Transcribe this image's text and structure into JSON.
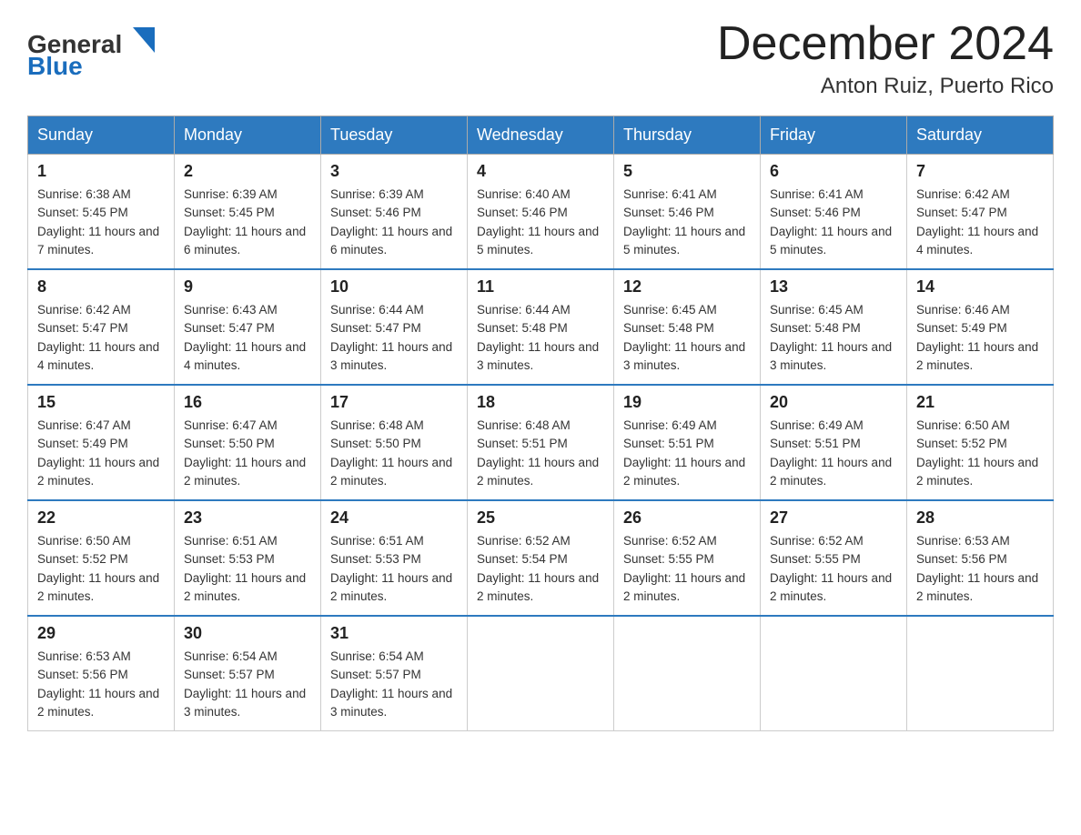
{
  "header": {
    "logo_text_general": "General",
    "logo_text_blue": "Blue",
    "title": "December 2024",
    "subtitle": "Anton Ruiz, Puerto Rico"
  },
  "calendar": {
    "headers": [
      "Sunday",
      "Monday",
      "Tuesday",
      "Wednesday",
      "Thursday",
      "Friday",
      "Saturday"
    ],
    "weeks": [
      [
        {
          "day": "1",
          "sunrise": "Sunrise: 6:38 AM",
          "sunset": "Sunset: 5:45 PM",
          "daylight": "Daylight: 11 hours and 7 minutes."
        },
        {
          "day": "2",
          "sunrise": "Sunrise: 6:39 AM",
          "sunset": "Sunset: 5:45 PM",
          "daylight": "Daylight: 11 hours and 6 minutes."
        },
        {
          "day": "3",
          "sunrise": "Sunrise: 6:39 AM",
          "sunset": "Sunset: 5:46 PM",
          "daylight": "Daylight: 11 hours and 6 minutes."
        },
        {
          "day": "4",
          "sunrise": "Sunrise: 6:40 AM",
          "sunset": "Sunset: 5:46 PM",
          "daylight": "Daylight: 11 hours and 5 minutes."
        },
        {
          "day": "5",
          "sunrise": "Sunrise: 6:41 AM",
          "sunset": "Sunset: 5:46 PM",
          "daylight": "Daylight: 11 hours and 5 minutes."
        },
        {
          "day": "6",
          "sunrise": "Sunrise: 6:41 AM",
          "sunset": "Sunset: 5:46 PM",
          "daylight": "Daylight: 11 hours and 5 minutes."
        },
        {
          "day": "7",
          "sunrise": "Sunrise: 6:42 AM",
          "sunset": "Sunset: 5:47 PM",
          "daylight": "Daylight: 11 hours and 4 minutes."
        }
      ],
      [
        {
          "day": "8",
          "sunrise": "Sunrise: 6:42 AM",
          "sunset": "Sunset: 5:47 PM",
          "daylight": "Daylight: 11 hours and 4 minutes."
        },
        {
          "day": "9",
          "sunrise": "Sunrise: 6:43 AM",
          "sunset": "Sunset: 5:47 PM",
          "daylight": "Daylight: 11 hours and 4 minutes."
        },
        {
          "day": "10",
          "sunrise": "Sunrise: 6:44 AM",
          "sunset": "Sunset: 5:47 PM",
          "daylight": "Daylight: 11 hours and 3 minutes."
        },
        {
          "day": "11",
          "sunrise": "Sunrise: 6:44 AM",
          "sunset": "Sunset: 5:48 PM",
          "daylight": "Daylight: 11 hours and 3 minutes."
        },
        {
          "day": "12",
          "sunrise": "Sunrise: 6:45 AM",
          "sunset": "Sunset: 5:48 PM",
          "daylight": "Daylight: 11 hours and 3 minutes."
        },
        {
          "day": "13",
          "sunrise": "Sunrise: 6:45 AM",
          "sunset": "Sunset: 5:48 PM",
          "daylight": "Daylight: 11 hours and 3 minutes."
        },
        {
          "day": "14",
          "sunrise": "Sunrise: 6:46 AM",
          "sunset": "Sunset: 5:49 PM",
          "daylight": "Daylight: 11 hours and 2 minutes."
        }
      ],
      [
        {
          "day": "15",
          "sunrise": "Sunrise: 6:47 AM",
          "sunset": "Sunset: 5:49 PM",
          "daylight": "Daylight: 11 hours and 2 minutes."
        },
        {
          "day": "16",
          "sunrise": "Sunrise: 6:47 AM",
          "sunset": "Sunset: 5:50 PM",
          "daylight": "Daylight: 11 hours and 2 minutes."
        },
        {
          "day": "17",
          "sunrise": "Sunrise: 6:48 AM",
          "sunset": "Sunset: 5:50 PM",
          "daylight": "Daylight: 11 hours and 2 minutes."
        },
        {
          "day": "18",
          "sunrise": "Sunrise: 6:48 AM",
          "sunset": "Sunset: 5:51 PM",
          "daylight": "Daylight: 11 hours and 2 minutes."
        },
        {
          "day": "19",
          "sunrise": "Sunrise: 6:49 AM",
          "sunset": "Sunset: 5:51 PM",
          "daylight": "Daylight: 11 hours and 2 minutes."
        },
        {
          "day": "20",
          "sunrise": "Sunrise: 6:49 AM",
          "sunset": "Sunset: 5:51 PM",
          "daylight": "Daylight: 11 hours and 2 minutes."
        },
        {
          "day": "21",
          "sunrise": "Sunrise: 6:50 AM",
          "sunset": "Sunset: 5:52 PM",
          "daylight": "Daylight: 11 hours and 2 minutes."
        }
      ],
      [
        {
          "day": "22",
          "sunrise": "Sunrise: 6:50 AM",
          "sunset": "Sunset: 5:52 PM",
          "daylight": "Daylight: 11 hours and 2 minutes."
        },
        {
          "day": "23",
          "sunrise": "Sunrise: 6:51 AM",
          "sunset": "Sunset: 5:53 PM",
          "daylight": "Daylight: 11 hours and 2 minutes."
        },
        {
          "day": "24",
          "sunrise": "Sunrise: 6:51 AM",
          "sunset": "Sunset: 5:53 PM",
          "daylight": "Daylight: 11 hours and 2 minutes."
        },
        {
          "day": "25",
          "sunrise": "Sunrise: 6:52 AM",
          "sunset": "Sunset: 5:54 PM",
          "daylight": "Daylight: 11 hours and 2 minutes."
        },
        {
          "day": "26",
          "sunrise": "Sunrise: 6:52 AM",
          "sunset": "Sunset: 5:55 PM",
          "daylight": "Daylight: 11 hours and 2 minutes."
        },
        {
          "day": "27",
          "sunrise": "Sunrise: 6:52 AM",
          "sunset": "Sunset: 5:55 PM",
          "daylight": "Daylight: 11 hours and 2 minutes."
        },
        {
          "day": "28",
          "sunrise": "Sunrise: 6:53 AM",
          "sunset": "Sunset: 5:56 PM",
          "daylight": "Daylight: 11 hours and 2 minutes."
        }
      ],
      [
        {
          "day": "29",
          "sunrise": "Sunrise: 6:53 AM",
          "sunset": "Sunset: 5:56 PM",
          "daylight": "Daylight: 11 hours and 2 minutes."
        },
        {
          "day": "30",
          "sunrise": "Sunrise: 6:54 AM",
          "sunset": "Sunset: 5:57 PM",
          "daylight": "Daylight: 11 hours and 3 minutes."
        },
        {
          "day": "31",
          "sunrise": "Sunrise: 6:54 AM",
          "sunset": "Sunset: 5:57 PM",
          "daylight": "Daylight: 11 hours and 3 minutes."
        },
        null,
        null,
        null,
        null
      ]
    ]
  }
}
